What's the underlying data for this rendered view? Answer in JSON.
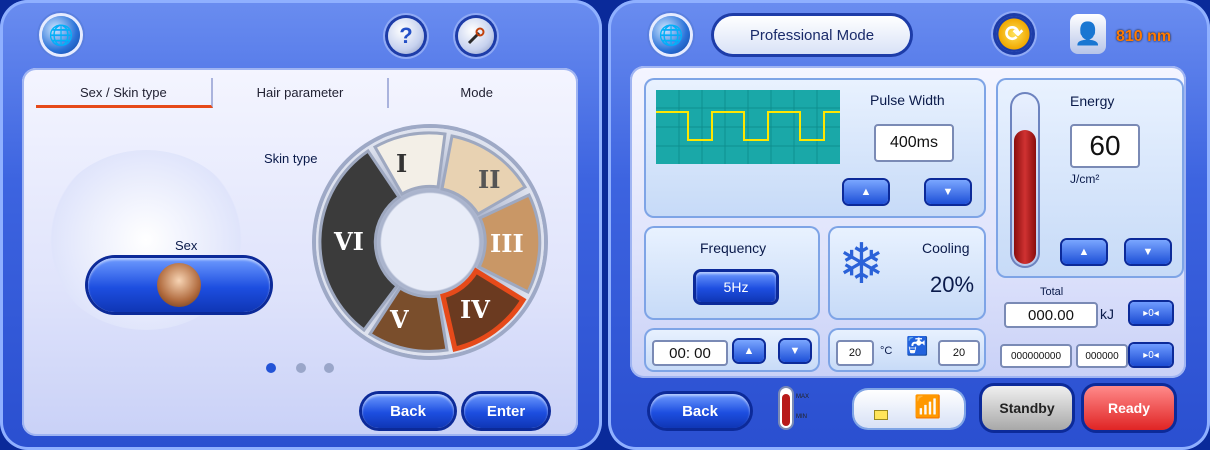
{
  "left": {
    "tabs": [
      "Sex / Skin type",
      "Hair parameter",
      "Mode"
    ],
    "skin_type_label": "Skin type",
    "skin_types": [
      "I",
      "II",
      "III",
      "IV",
      "V",
      "VI"
    ],
    "sex_label": "Sex",
    "page_dots": 3,
    "back_label": "Back",
    "enter_label": "Enter"
  },
  "right": {
    "mode_title": "Professional  Mode",
    "wavelength": "810 nm",
    "pulse_width_label": "Pulse Width",
    "pulse_width_value": "400ms",
    "energy_label": "Energy",
    "energy_value": "60",
    "energy_unit": "J/cm²",
    "frequency_label": "Frequency",
    "frequency_value": "5Hz",
    "cooling_label": "Cooling",
    "cooling_value": "20%",
    "timer_value": "00: 00",
    "temp_value": "20",
    "temp_unit": "°C",
    "water_value": "20",
    "total_label": "Total",
    "total_value": "000.00",
    "total_unit": "kJ",
    "counter1": "000000000",
    "counter2": "000000",
    "max_label": "MAX",
    "min_label": "MIN",
    "back_label": "Back",
    "standby_label": "Standby",
    "ready_label": "Ready"
  }
}
